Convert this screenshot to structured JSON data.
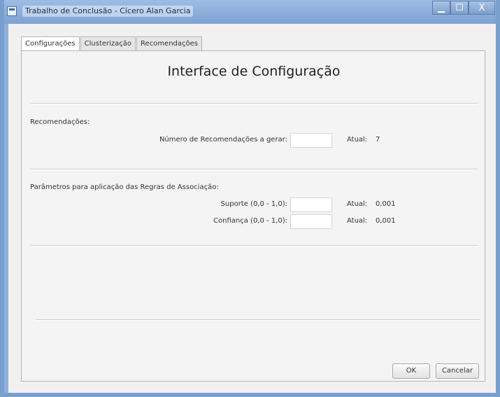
{
  "window": {
    "title": "Trabalho de Conclusão - Cícero Alan Garcia",
    "minimize_glyph": "▁",
    "maximize_glyph": "☐",
    "close_glyph": "X"
  },
  "tabs": [
    {
      "label": "Configurações",
      "active": true
    },
    {
      "label": "Clusterização",
      "active": false
    },
    {
      "label": "Recomendações",
      "active": false
    }
  ],
  "heading": "Interface de Configuração",
  "recomendacoes": {
    "section_label": "Recomendações:",
    "field_label": "Número de Recomendações a gerar:",
    "value": "",
    "atual_label": "Atual:",
    "atual_value": "7"
  },
  "regras": {
    "section_label": "Parâmetros para aplicação das Regras de Associação:",
    "suporte_label": "Suporte (0,0 - 1,0):",
    "suporte_value": "",
    "suporte_atual_label": "Atual:",
    "suporte_atual_value": "0,001",
    "confianca_label": "Confiança (0,0 - 1,0):",
    "confianca_value": "",
    "confianca_atual_label": "Atual:",
    "confianca_atual_value": "0,001"
  },
  "buttons": {
    "ok": "OK",
    "cancel": "Cancelar"
  },
  "colors": {
    "titlebar": "#8fb0db",
    "background": "#f1f1f1"
  }
}
